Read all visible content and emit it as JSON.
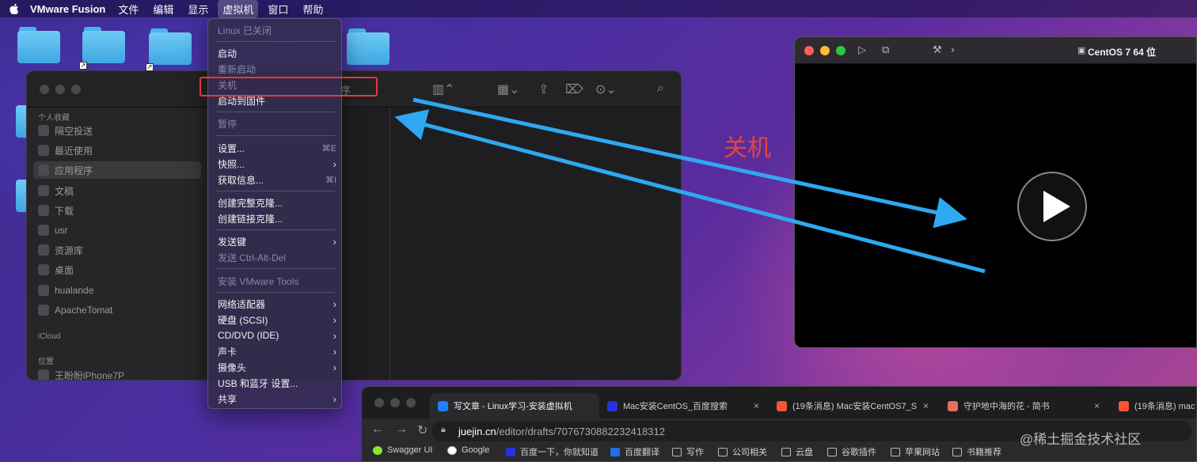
{
  "menubar": {
    "app_name": "VMware Fusion",
    "menus": [
      "文件",
      "编辑",
      "显示",
      "虚拟机",
      "窗口",
      "帮助"
    ]
  },
  "finder": {
    "sidebar_sections": {
      "favorites": "个人收藏",
      "icloud": "iCloud",
      "locations": "位置"
    },
    "favorites": [
      "隔空投送",
      "最近使用",
      "应用程序",
      "文稿",
      "下载",
      "usr",
      "资源库",
      "桌面",
      "hualande",
      "ApacheTomat"
    ],
    "location_device": "王盼盼iPhone7P",
    "toolbar_partial_title": "序"
  },
  "context_menu": {
    "items": [
      {
        "label": "Linux 已关闭",
        "disabled": true
      },
      {
        "label": "启动"
      },
      {
        "label": "重新启动",
        "disabled": true
      },
      {
        "label": "关机",
        "disabled": true
      },
      {
        "label": "启动到固件"
      },
      {
        "label": "暂停",
        "disabled": true
      },
      {
        "label": "设置...",
        "shortcut": "⌘E"
      },
      {
        "label": "快照...",
        "submenu": true
      },
      {
        "label": "获取信息...",
        "shortcut": "⌘I"
      },
      {
        "label": "创建完整克隆..."
      },
      {
        "label": "创建链接克隆..."
      },
      {
        "label": "发送键",
        "submenu": true
      },
      {
        "label": "发送 Ctrl-Alt-Del",
        "disabled": true
      },
      {
        "label": "安装 VMware Tools",
        "disabled": true
      },
      {
        "label": "网络适配器",
        "submenu": true
      },
      {
        "label": "硬盘 (SCSI)",
        "submenu": true
      },
      {
        "label": "CD/DVD (IDE)",
        "submenu": true
      },
      {
        "label": "声卡",
        "submenu": true
      },
      {
        "label": "摄像头",
        "submenu": true
      },
      {
        "label": "USB 和蓝牙 设置..."
      },
      {
        "label": "共享",
        "submenu": true
      }
    ]
  },
  "vm_window": {
    "title": "CentOS 7 64 位"
  },
  "annotation": "关机",
  "browser": {
    "tabs": [
      {
        "label": "写文章 - Linux学习-安装虚拟机",
        "favicon_color": "#1e80ff"
      },
      {
        "label": "Mac安装CentOS_百度搜索",
        "favicon_color": "#2932e1"
      },
      {
        "label": "(19条消息) Mac安装CentOS7_S",
        "favicon_color": "#fc5531"
      },
      {
        "label": "守护地中海的花 - 简书",
        "favicon_color": "#ea6f5a"
      },
      {
        "label": "(19条消息) mac",
        "favicon_color": "#fc5531"
      }
    ],
    "url_host": "juejin.cn",
    "url_path": "/editor/drafts/7076730882232418312",
    "bookmarks": [
      "Swagger UI",
      "Google",
      "百度一下，你就知道",
      "百度翻译",
      "写作",
      "公司相关",
      "云盘",
      "谷歌插件",
      "苹果网站",
      "书籍推荐"
    ]
  },
  "watermark": "@稀土掘金技术社区"
}
